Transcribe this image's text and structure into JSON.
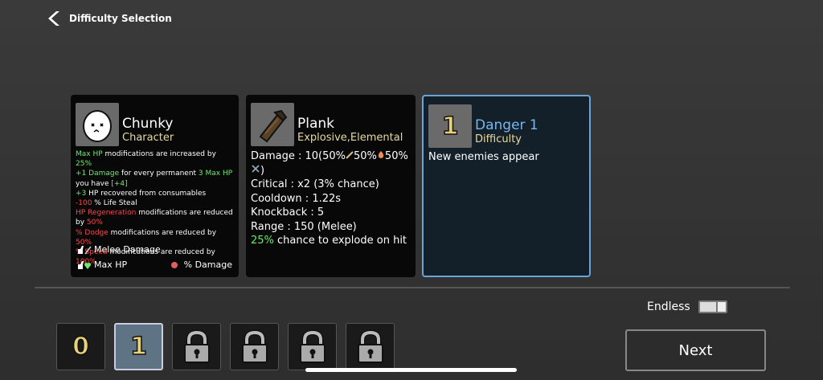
{
  "header": {
    "title": "Difficulty Selection"
  },
  "character": {
    "name": "Chunky",
    "type": "Character",
    "lines": {
      "l1_a": "Max HP",
      "l1_b": " modifications are increased by ",
      "l1_c": "25%",
      "l2_a": "+1",
      "l2_b": "  Damage",
      "l2_c": " for every permanent ",
      "l2_d": "3 Max HP",
      "l3_a": "you have ",
      "l3_b": "[+4]",
      "l4_a": "+3",
      "l4_b": "  HP recovered from consumables",
      "l5_a": "-100",
      "l5_b": " % Life Steal",
      "l6_a": "HP Regeneration",
      "l6_b": " modifications are reduced",
      "l7_a": "by ",
      "l7_b": "50%",
      "l8_a": "% Dodge",
      "l8_b": " modifications are reduced by ",
      "l8_c": "50%",
      "l9_a": "% Speed",
      "l9_b": " modifications are reduced by ",
      "l9_c": "100%"
    },
    "tags": {
      "melee": "Melee Damage",
      "maxhp": "Max HP",
      "pct_damage": "% Damage"
    }
  },
  "weapon": {
    "name": "Plank",
    "type": "Explosive,Elemental",
    "damage_line": "Damage : 10(50%",
    "damage_p2": "50%",
    "damage_p3": "50%",
    "damage_p4": ")",
    "critical": "Critical : x2 (3% chance)",
    "cooldown": "Cooldown : 1.22s",
    "knockback": "Knockback : 5",
    "range": "Range : 150 (Melee)",
    "explode_pct": "25%",
    "explode_text": " chance to explode on hit"
  },
  "danger": {
    "number": "1",
    "name": "Danger 1",
    "type": "Difficulty",
    "desc": "New enemies appear"
  },
  "endless": {
    "label": "Endless"
  },
  "slots": [
    {
      "label": "0",
      "locked": false,
      "selected": false
    },
    {
      "label": "1",
      "locked": false,
      "selected": true
    },
    {
      "label": "",
      "locked": true
    },
    {
      "label": "",
      "locked": true
    },
    {
      "label": "",
      "locked": true
    },
    {
      "label": "",
      "locked": true
    }
  ],
  "next_label": "Next",
  "colors": {
    "positive": "#6ee96e",
    "negative": "#ff4646",
    "accent": "#77b6ee",
    "gold": "#e7d27a"
  }
}
